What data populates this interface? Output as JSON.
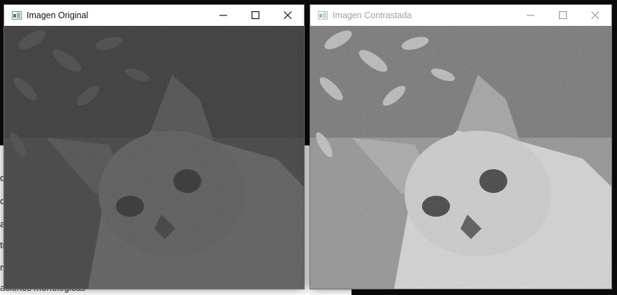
{
  "background": {
    "menu_text": [
      "d",
      "d",
      "a",
      "tr",
      "m",
      "aciones morfológicas"
    ]
  },
  "windows": [
    {
      "title": "Imagen Original",
      "state": "active",
      "image": {
        "description_icon": "cat-photo",
        "brightness": "dark"
      }
    },
    {
      "title": "Imagen Contrastada",
      "state": "inactive",
      "image": {
        "description_icon": "cat-photo",
        "brightness": "high-contrast"
      }
    }
  ],
  "controls": {
    "minimize": "minimize-icon",
    "maximize": "maximize-icon",
    "close": "close-icon"
  },
  "colors": {
    "console_green": "#3cd23c",
    "titlebar": "#ffffff",
    "inactive_title": "#a0a0a0"
  }
}
